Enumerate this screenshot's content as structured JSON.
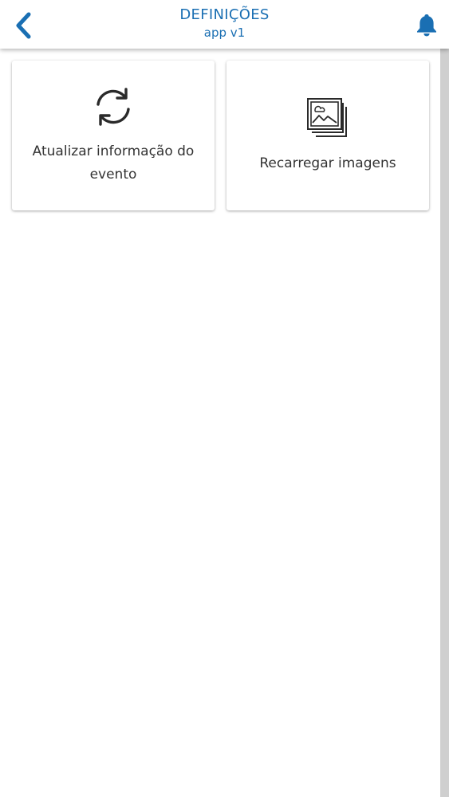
{
  "header": {
    "title": "DEFINIÇÕES",
    "subtitle": "app v1",
    "back_icon": "chevron-left-icon",
    "bell_icon": "bell-icon",
    "accent_color": "#1a6fb3"
  },
  "cards": [
    {
      "label": "Atualizar informação do evento",
      "icon": "refresh-icon"
    },
    {
      "label": "Recarregar imagens",
      "icon": "images-stack-icon"
    }
  ]
}
